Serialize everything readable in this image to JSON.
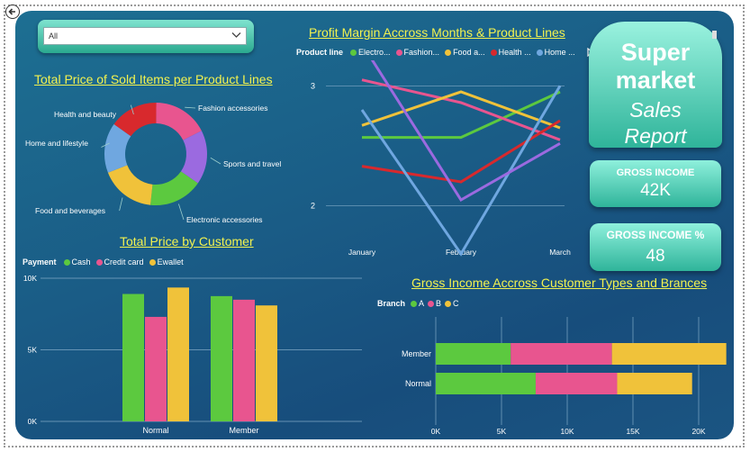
{
  "slicer": {
    "value": "All"
  },
  "titles": {
    "donut": "Total Price of Sold Items per Product Lines",
    "line": "Profit Margin Accross Months & Product Lines",
    "bar": "Total Price by Customer",
    "hbar": "Gross Income Accross Customer Types and Brances"
  },
  "brand": {
    "line1": "Super",
    "line2": "market",
    "line3": "Sales",
    "line4": "Report"
  },
  "kpis": [
    {
      "label": "GROSS INCOME",
      "value": "42K"
    },
    {
      "label": "GROSS INCOME %",
      "value": "48"
    }
  ],
  "colors": {
    "green": "#5cc93f",
    "pink": "#e8558f",
    "yellow": "#f0c23a",
    "red": "#d8292d",
    "blue": "#6fa7e0",
    "purple": "#9b6ae0"
  },
  "chart_data": [
    {
      "type": "pie",
      "title": "Total Price of Sold Items per Product Lines",
      "categories": [
        "Fashion accessories",
        "Sports and travel",
        "Electronic accessories",
        "Food and beverages",
        "Home and lifestyle",
        "Health and beauty"
      ],
      "values": [
        17.4,
        17.1,
        17.0,
        17.4,
        15.8,
        15.3
      ],
      "colors": [
        "#e8558f",
        "#9b6ae0",
        "#5cc93f",
        "#f0c23a",
        "#6fa7e0",
        "#d8292d"
      ]
    },
    {
      "type": "line",
      "title": "Profit Margin Accross Months & Product Lines",
      "legend_title": "Product line",
      "legend_labels": [
        "Electro...",
        "Fashion...",
        "Food a...",
        "Health ...",
        "Home ..."
      ],
      "x": [
        "January",
        "February",
        "March"
      ],
      "yticks": [
        2,
        3
      ],
      "ylim": [
        1.75,
        3.4
      ],
      "series": [
        {
          "name": "Electro...",
          "color": "#5cc93f",
          "values": [
            2.57,
            2.57,
            2.95
          ]
        },
        {
          "name": "Fashion...",
          "color": "#e8558f",
          "values": [
            3.05,
            2.86,
            2.55
          ]
        },
        {
          "name": "Food a...",
          "color": "#f0c23a",
          "values": [
            2.67,
            2.95,
            2.65
          ]
        },
        {
          "name": "Health ...",
          "color": "#d8292d",
          "values": [
            2.33,
            2.2,
            2.71
          ]
        },
        {
          "name": "Home ...",
          "color": "#6fa7e0",
          "values": [
            2.8,
            1.6,
            3.0
          ]
        },
        {
          "name": "",
          "color": "#9b6ae0",
          "values": [
            3.35,
            2.05,
            2.52
          ]
        }
      ]
    },
    {
      "type": "bar",
      "title": "Total Price by Customer",
      "legend_title": "Payment",
      "categories": [
        "Normal",
        "Member"
      ],
      "yticks": [
        "0K",
        "5K",
        "10K"
      ],
      "ylim": [
        0,
        10000
      ],
      "series": [
        {
          "name": "Cash",
          "color": "#5cc93f",
          "values": [
            8900,
            8750
          ]
        },
        {
          "name": "Credit card",
          "color": "#e8558f",
          "values": [
            7300,
            8500
          ]
        },
        {
          "name": "Ewallet",
          "color": "#f0c23a",
          "values": [
            9350,
            8100
          ]
        }
      ]
    },
    {
      "type": "bar",
      "orientation": "horizontal-stacked",
      "title": "Gross Income Accross Customer Types and Brances",
      "legend_title": "Branch",
      "categories": [
        "Member",
        "Normal"
      ],
      "xticks": [
        "0K",
        "5K",
        "10K",
        "15K",
        "20K"
      ],
      "xlim": [
        0,
        22000
      ],
      "series": [
        {
          "name": "A",
          "color": "#5cc93f",
          "values": [
            5700,
            7600
          ]
        },
        {
          "name": "B",
          "color": "#e8558f",
          "values": [
            7700,
            6200
          ]
        },
        {
          "name": "C",
          "color": "#f0c23a",
          "values": [
            8700,
            5700
          ]
        }
      ]
    }
  ]
}
